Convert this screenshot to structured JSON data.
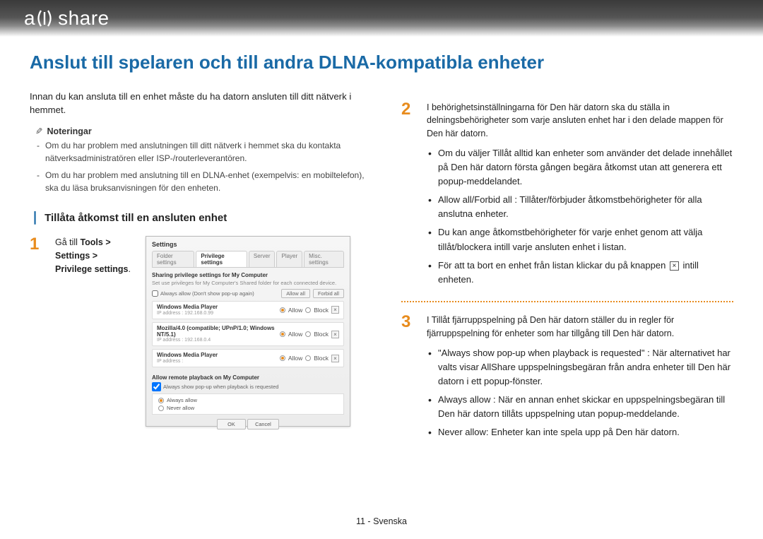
{
  "logo": {
    "text_before": "a",
    "text_after": "share"
  },
  "title": "Anslut till spelaren och till andra DLNA-kompatibla enheter",
  "intro": "Innan du kan ansluta till en enhet måste du ha datorn ansluten till ditt nätverk i hemmet.",
  "notes_heading": "Noteringar",
  "notes": [
    "Om du har problem med anslutningen till ditt nätverk i hemmet ska du kontakta nätverksadministratören eller ISP-/routerleverantören.",
    "Om du har problem med anslutning till en DLNA-enhet (exempelvis: en mobiltelefon), ska du läsa bruksanvisningen för den enheten."
  ],
  "section_heading": "Tillåta åtkomst till en ansluten enhet",
  "step1": {
    "prefix": "Gå till ",
    "bold": "Tools > Settings > Privilege settings",
    "suffix": "."
  },
  "screenshot": {
    "win_title": "Settings",
    "tabs": [
      "Folder settings",
      "Privilege settings",
      "Server",
      "Player",
      "Misc. settings"
    ],
    "active_tab_index": 1,
    "sub_title": "Sharing privilege settings for My Computer",
    "hint": "Set use privileges for My Computer's Shared folder for each connected device.",
    "chk_label": "Always allow (Don't show pop-up again)",
    "allow_all": "Allow all",
    "forbid_all": "Forbid all",
    "opt_allow": "Allow",
    "opt_block": "Block",
    "devices": [
      {
        "name": "Windows Media Player",
        "addr": "IP address : 192.168.0.99"
      },
      {
        "name": "Mozilla/4.0 (compatible; UPnP/1.0; Windows NT/5.1)",
        "addr": "IP address : 192.168.0.4"
      },
      {
        "name": "Windows Media Player",
        "addr": "IP address :"
      }
    ],
    "sec2_title": "Allow remote playback on My Computer",
    "sec2_chk": "Always show pop-up when playback is requested",
    "opt_always": "Always allow",
    "opt_never": "Never allow",
    "ok": "OK",
    "cancel": "Cancel"
  },
  "step2": {
    "intro": "I behörighetsinställningarna för Den här datorn ska du ställa in delningsbehörigheter som varje ansluten enhet har i den delade mappen för Den här datorn.",
    "bullets": [
      "Om du väljer Tillåt alltid kan enheter som använder det delade innehållet på Den här datorn första gången begära åtkomst utan att generera ett popup-meddelandet.",
      "Allow all/Forbid all : Tillåter/förbjuder åtkomstbehörigheter för alla anslutna enheter.",
      "Du kan ange åtkomstbehörigheter för varje enhet genom att välja tillåt/blockera intill varje ansluten enhet i listan."
    ],
    "bullet_x_before": "För att ta bort en enhet från listan klickar du på knappen ",
    "bullet_x_after": " intill enheten."
  },
  "step3": {
    "intro": "I Tillåt fjärruppspelning på Den här datorn ställer du in regler för fjärruppspelning för enheter som har tillgång till Den här datorn.",
    "bullets": [
      "\"Always show pop-up when playback is requested\" : När alternativet har valts visar AllShare uppspelningsbegäran från andra enheter till Den här datorn i ett popup-fönster.",
      "Always allow : När en annan enhet skickar en uppspelningsbegäran till Den här datorn tillåts uppspelning utan popup-meddelande.",
      "Never allow: Enheter kan inte spela upp på Den här datorn."
    ]
  },
  "footer": "11 - Svenska"
}
